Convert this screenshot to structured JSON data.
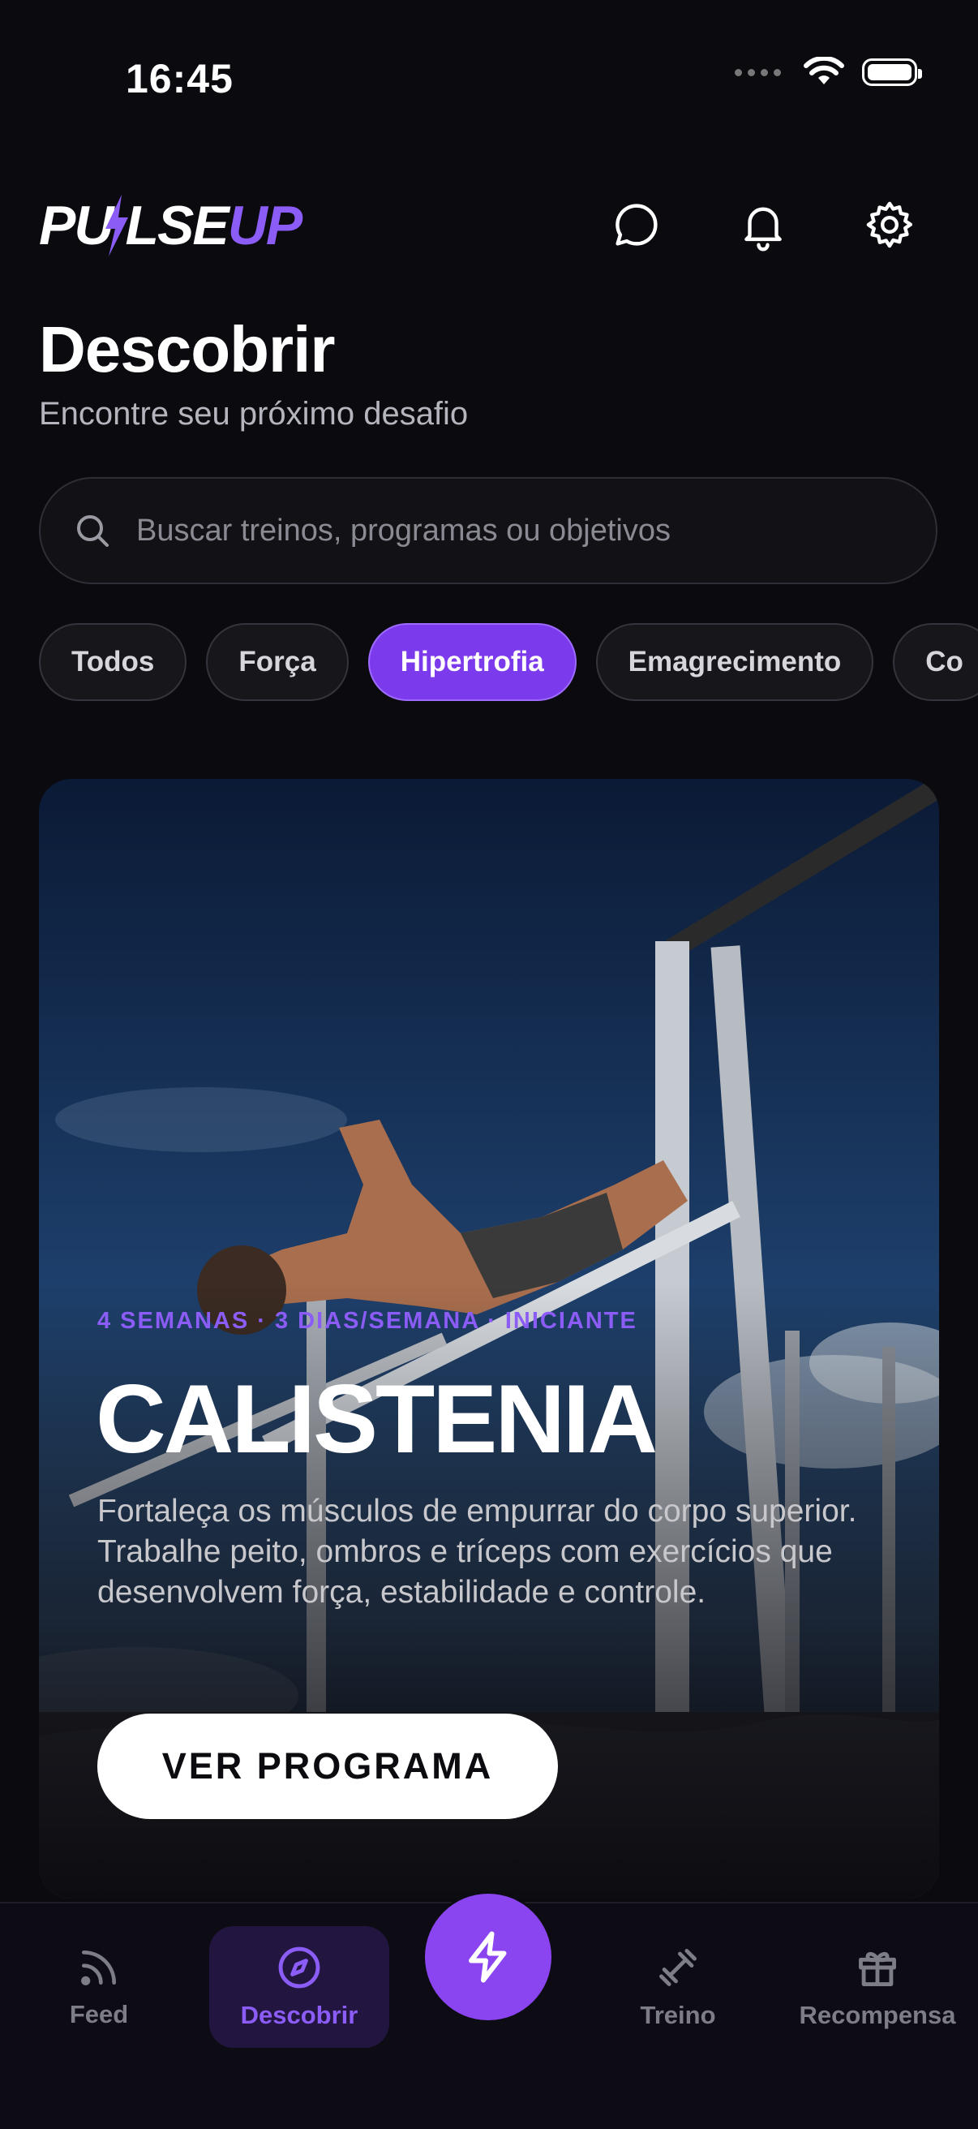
{
  "status_bar": {
    "time": "16:45"
  },
  "header": {
    "logo_part1": "PU",
    "logo_part2": "LSE",
    "logo_part3": "UP"
  },
  "page": {
    "title": "Descobrir",
    "subtitle": "Encontre seu próximo desafio"
  },
  "search": {
    "placeholder": "Buscar treinos, programas ou objetivos"
  },
  "chips": [
    {
      "label": "Todos",
      "active": false
    },
    {
      "label": "Força",
      "active": false
    },
    {
      "label": "Hipertrofia",
      "active": true
    },
    {
      "label": "Emagrecimento",
      "active": false
    },
    {
      "label": "Co",
      "active": false
    }
  ],
  "featured": {
    "meta": "4 SEMANAS · 3 DIAS/SEMANA · INICIANTE",
    "title": "CALISTENIA",
    "description": "Fortaleça os músculos de empurrar do corpo superior. Trabalhe peito, ombros e tríceps com exercícios que desenvolvem força, estabilidade e controle.",
    "cta": "VER PROGRAMA"
  },
  "nav": {
    "items": [
      {
        "label": "Feed",
        "icon": "feed-icon"
      },
      {
        "label": "Descobrir",
        "icon": "compass-icon",
        "active": true
      },
      {
        "label": "Treino",
        "icon": "dumbbell-icon"
      },
      {
        "label": "Recompensa",
        "icon": "gift-icon"
      }
    ],
    "fab_icon": "lightning-icon"
  },
  "colors": {
    "accent": "#8b5cf6",
    "background": "#0a0a0f"
  }
}
